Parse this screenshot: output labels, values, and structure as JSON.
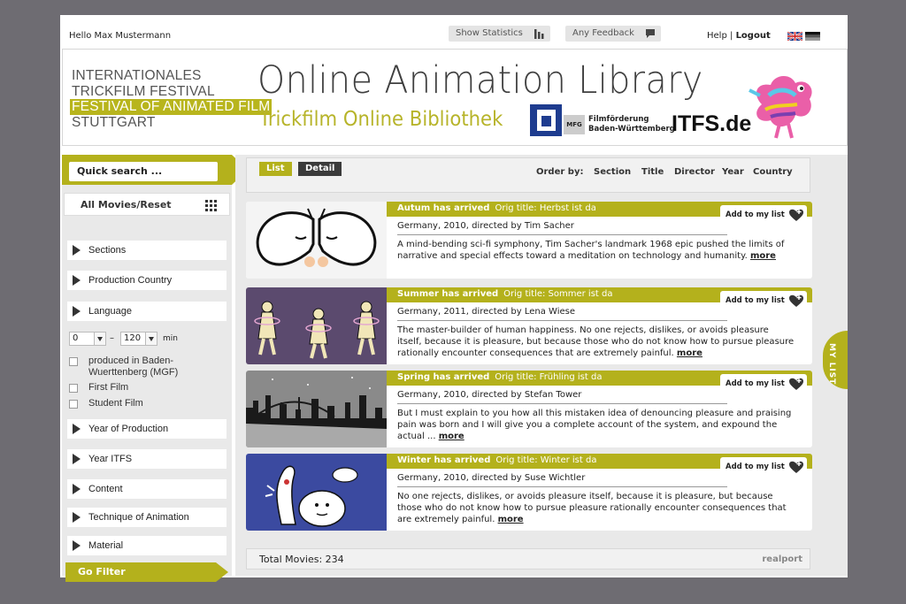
{
  "topbar": {
    "greeting": "Hello Max Mustermann",
    "show_statistics": "Show Statistics",
    "any_feedback": "Any Feedback",
    "help": "Help",
    "separator": "|",
    "logout": "Logout"
  },
  "header": {
    "festival_lines": [
      "INTERNATIONALES",
      "TRICKFILM FESTIVAL",
      "FESTIVAL OF ANIMATED FILM",
      "STUTTGART"
    ],
    "title": "Online Animation Library",
    "subtitle": "Trickfilm Online Bibliothek",
    "mfg_label": "MFG",
    "mfg_text_1": "Filmförderung",
    "mfg_text_2": "Baden-Württemberg",
    "itfs": "ITFS.de"
  },
  "sidebar": {
    "quick_search": "Quick search ...",
    "all_movies": "All Movies/Reset",
    "filters_top": [
      "Sections",
      "Production Country",
      "Language"
    ],
    "range": {
      "from": "0",
      "dash": "–",
      "to": "120",
      "unit": "min"
    },
    "checks": [
      "produced in Baden-Wuerttenberg (MGF)",
      "First Film",
      "Student Film"
    ],
    "filters_bottom": [
      "Year of Production",
      "Year ITFS",
      "Content",
      "Technique of Animation",
      "Material"
    ],
    "go_filter": "Go Filter"
  },
  "toolbar": {
    "tab_list": "List",
    "tab_detail": "Detail",
    "order_by": "Order by:",
    "order_options": [
      "Section",
      "Title",
      "Director",
      "Year",
      "Country"
    ]
  },
  "movies": [
    {
      "title": "Autum has arrived",
      "orig": "Orig title: Herbst ist da",
      "meta": "Germany, 2010, directed by Tim Sacher",
      "desc": "A mind-bending sci-fi symphony, Tim Sacher's landmark 1968 epic pushed the limits of narrative and special effects toward a meditation on technology and humanity.",
      "more": "more",
      "add": "Add to my list"
    },
    {
      "title": "Summer has arrived",
      "orig": "Orig title: Sommer ist da",
      "meta": "Germany, 2011, directed by Lena Wiese",
      "desc": "The master-builder of human happiness. No one rejects, dislikes, or avoids pleasure itself, because it is pleasure, but because those who do not know how to pursue pleasure rationally encounter consequences that are extremely painful.",
      "more": "more",
      "add": "Add to my list"
    },
    {
      "title": "Spring has arrived",
      "orig": "Orig title: Frühling ist da",
      "meta": "Germany, 2010, directed by Stefan Tower",
      "desc": "But I must explain to you how all this mistaken idea of denouncing pleasure and praising pain was born and I will give you a complete account of the system, and expound the actual ...",
      "more": "more",
      "add": "Add to my list"
    },
    {
      "title": "Winter has arrived",
      "orig": "Orig title: Winter ist da",
      "meta": "Germany, 2010, directed by Suse Wichtler",
      "desc": "No one rejects, dislikes, or avoids pleasure itself, because it is pleasure, but because those who do not know how to pursue pleasure rationally encounter consequences that are extremely painful.",
      "more": "more",
      "add": "Add to my list"
    }
  ],
  "footer": {
    "total": "Total Movies: 234",
    "brand": "realport"
  },
  "my_list": "MY LIST",
  "colors": {
    "accent": "#b4b11c",
    "background": "#6e6c72",
    "panel": "#e9e9e9"
  }
}
